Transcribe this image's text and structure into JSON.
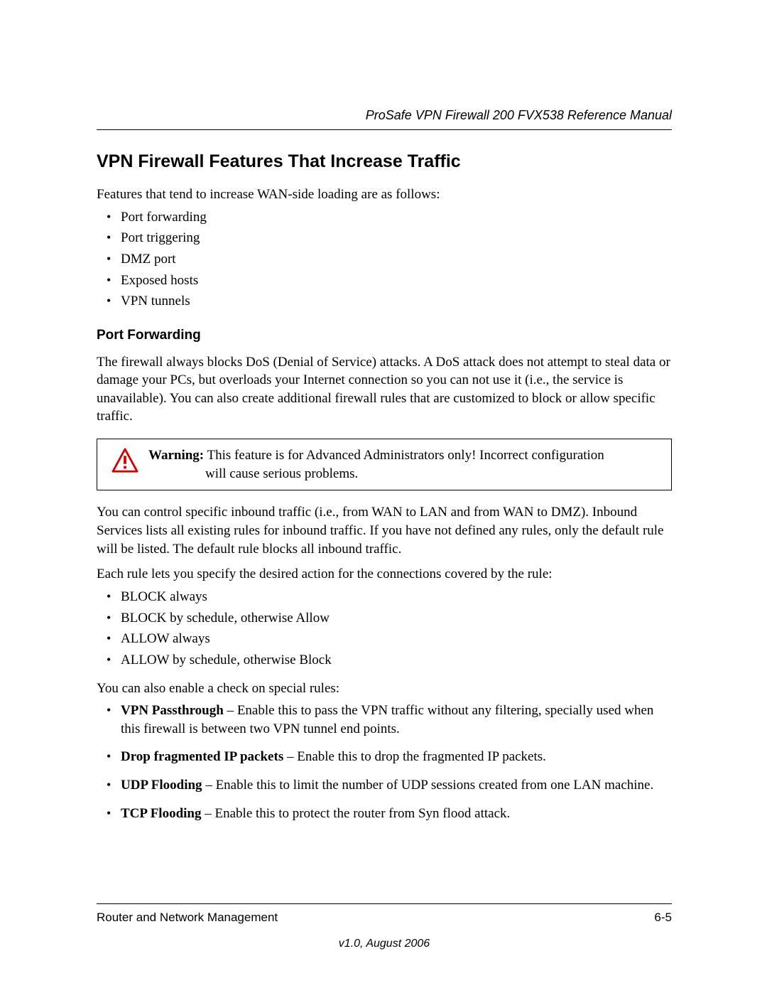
{
  "header": {
    "running_head": "ProSafe VPN Firewall 200 FVX538 Reference Manual"
  },
  "section": {
    "title": "VPN Firewall Features That Increase Traffic",
    "intro": "Features that tend to increase WAN-side loading are as follows:",
    "feature_list": [
      "Port forwarding",
      "Port triggering",
      "DMZ port",
      "Exposed hosts",
      "VPN tunnels"
    ],
    "subhead": "Port Forwarding",
    "pf_para": "The firewall always blocks DoS (Denial of Service) attacks. A DoS attack does not attempt to steal data or damage your PCs, but overloads your Internet connection so you can not use it (i.e., the service is unavailable). You can also create additional firewall rules that are customized to block or allow specific traffic.",
    "warning": {
      "label": "Warning:",
      "line1": " This feature is for Advanced Administrators only! Incorrect configuration",
      "line2": "will cause serious problems."
    },
    "after_warning_para": "You can control specific inbound traffic (i.e., from WAN to LAN and from WAN to DMZ). Inbound Services lists all existing rules for inbound traffic. If you have not defined any rules, only the default rule will be listed. The default rule blocks all inbound traffic.",
    "rule_intro": "Each rule lets you specify the desired action for the connections covered by the rule:",
    "rule_actions": [
      "BLOCK always",
      "BLOCK by schedule, otherwise Allow",
      "ALLOW always",
      "ALLOW by schedule, otherwise Block"
    ],
    "special_intro": "You can also enable a check on special rules:",
    "special_rules": [
      {
        "name": "VPN Passthrough",
        "desc": " – Enable this to pass the VPN traffic without any filtering, specially used when this firewall is between two VPN tunnel end points."
      },
      {
        "name": "Drop fragmented IP packets",
        "desc": " – Enable this to drop the fragmented IP packets."
      },
      {
        "name": "UDP Flooding",
        "desc": " – Enable this to limit the number of UDP sessions created from one LAN machine."
      },
      {
        "name": "TCP Flooding",
        "desc": " – Enable this to protect the router from Syn flood attack."
      }
    ]
  },
  "footer": {
    "left": "Router and Network Management",
    "right": "6-5",
    "version": "v1.0, August 2006"
  }
}
